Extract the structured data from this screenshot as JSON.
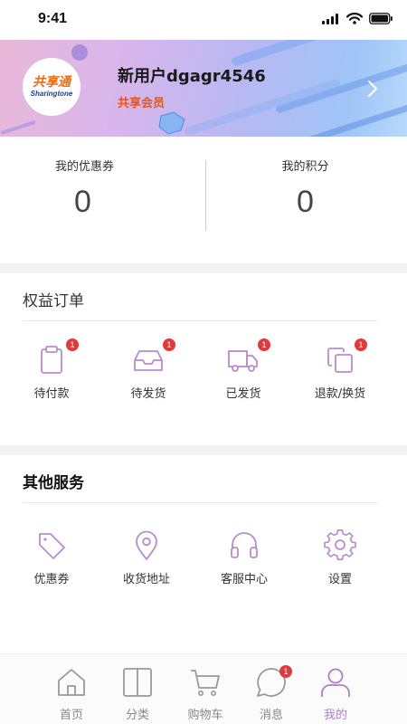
{
  "status_bar": {
    "time": "9:41"
  },
  "profile": {
    "logo_cn": "共享通",
    "logo_en": "Sharingtone",
    "username": "新用户dgagr4546",
    "member_tag": "共享会员"
  },
  "stats": {
    "coupons_label": "我的优惠券",
    "coupons_value": "0",
    "points_label": "我的积分",
    "points_value": "0"
  },
  "orders": {
    "title": "权益订单",
    "items": [
      {
        "label": "待付款",
        "badge": "1",
        "icon": "clipboard-icon"
      },
      {
        "label": "待发货",
        "badge": "1",
        "icon": "inbox-icon"
      },
      {
        "label": "已发货",
        "badge": "1",
        "icon": "truck-icon"
      },
      {
        "label": "退款/换货",
        "badge": "1",
        "icon": "copy-icon"
      }
    ]
  },
  "services": {
    "title": "其他服务",
    "items": [
      {
        "label": "优惠券",
        "icon": "tag-icon"
      },
      {
        "label": "收货地址",
        "icon": "location-pin-icon"
      },
      {
        "label": "客服中心",
        "icon": "headphones-icon"
      },
      {
        "label": "设置",
        "icon": "gear-icon"
      }
    ]
  },
  "tabbar": {
    "items": [
      {
        "label": "首页",
        "icon": "home-icon"
      },
      {
        "label": "分类",
        "icon": "category-icon"
      },
      {
        "label": "购物车",
        "icon": "cart-icon"
      },
      {
        "label": "消息",
        "icon": "message-icon",
        "badge": "1"
      },
      {
        "label": "我的",
        "icon": "user-icon",
        "active": true
      }
    ]
  },
  "colors": {
    "accent": "#b07fc3",
    "icon_purple": "#b98bcc",
    "badge_red": "#e0393e",
    "member_orange": "#e8541c"
  }
}
